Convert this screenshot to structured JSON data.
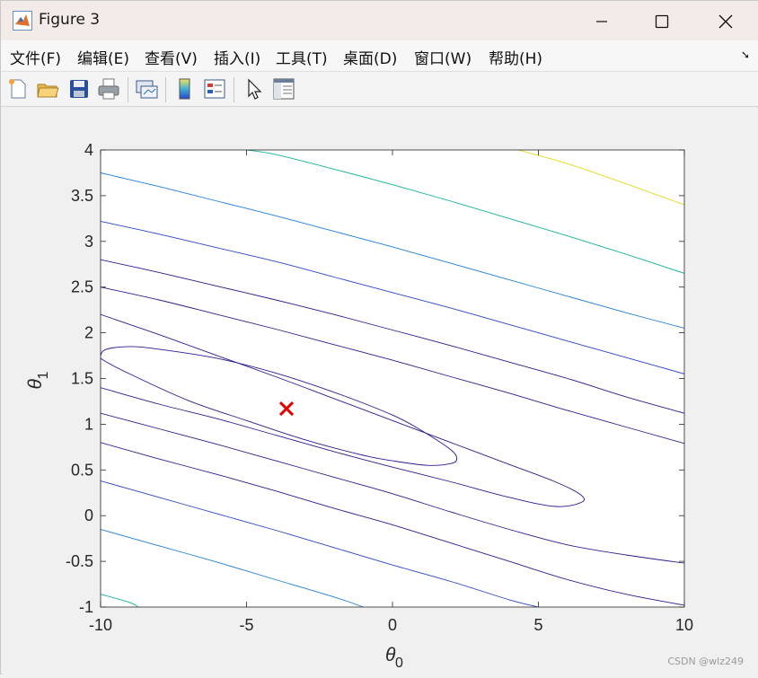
{
  "window": {
    "title": "Figure 3",
    "controls": [
      "minimize",
      "maximize",
      "close"
    ]
  },
  "menubar": {
    "items": [
      "文件(F)",
      "编辑(E)",
      "查看(V)",
      "插入(I)",
      "工具(T)",
      "桌面(D)",
      "窗口(W)",
      "帮助(H)"
    ],
    "dock_arrow": "➘"
  },
  "toolbar": {
    "icons": [
      "new-figure-icon",
      "open-file-icon",
      "save-icon",
      "print-icon",
      "link-plot-icon",
      "colorbar-icon",
      "legend-icon",
      "pointer-icon",
      "property-inspector-icon"
    ]
  },
  "chart_data": {
    "type": "contour",
    "xlim": [
      -10,
      10
    ],
    "ylim": [
      -1,
      4
    ],
    "xticks": [
      "-10",
      "-5",
      "0",
      "5",
      "10"
    ],
    "yticks": [
      "-1",
      "-0.5",
      "0",
      "0.5",
      "1",
      "1.5",
      "2",
      "2.5",
      "3",
      "3.5",
      "4"
    ],
    "xlabel_symbol": "θ",
    "xlabel_subscript": "0",
    "ylabel_symbol": "θ",
    "ylabel_subscript": "1",
    "grid": false,
    "marker": {
      "symbol": "x",
      "x": -3.63,
      "y": 1.17,
      "color": "#e00000"
    },
    "contour_colors": [
      "#2a1d8f",
      "#2b46c8",
      "#1f7fd8",
      "#14b39a",
      "#e6d81e"
    ],
    "contours": [
      {
        "level": 1,
        "color": "#2a1d8f",
        "closed": true,
        "points": [
          [
            -10,
            1.75
          ],
          [
            -9.8,
            1.82
          ],
          [
            -9.0,
            1.85
          ],
          [
            -8,
            1.82
          ],
          [
            -6,
            1.72
          ],
          [
            -4,
            1.56
          ],
          [
            -2,
            1.35
          ],
          [
            0,
            1.1
          ],
          [
            1,
            0.93
          ],
          [
            2.0,
            0.72
          ],
          [
            2.2,
            0.62
          ],
          [
            2.0,
            0.57
          ],
          [
            1.2,
            0.55
          ],
          [
            0,
            0.6
          ],
          [
            -1,
            0.66
          ],
          [
            -3,
            0.83
          ],
          [
            -5,
            1.04
          ],
          [
            -7,
            1.26
          ],
          [
            -9,
            1.55
          ],
          [
            -9.9,
            1.7
          ],
          [
            -10,
            1.75
          ]
        ]
      },
      {
        "level": 2,
        "color": "#2a1d8f",
        "closed": false,
        "points": [
          [
            -10,
            1.4
          ],
          [
            -8,
            1.22
          ],
          [
            -6,
            1.06
          ],
          [
            -4,
            0.88
          ],
          [
            -2,
            0.7
          ],
          [
            0,
            0.53
          ],
          [
            2,
            0.37
          ],
          [
            4,
            0.2
          ],
          [
            5.6,
            0.1
          ],
          [
            6.5,
            0.15
          ],
          [
            6.4,
            0.24
          ],
          [
            5.5,
            0.38
          ],
          [
            4,
            0.56
          ],
          [
            2,
            0.8
          ],
          [
            0,
            1.04
          ],
          [
            -2,
            1.28
          ],
          [
            -4,
            1.52
          ],
          [
            -6,
            1.75
          ],
          [
            -8,
            1.98
          ],
          [
            -10,
            2.2
          ]
        ]
      },
      {
        "level": 3,
        "color": "#2a1d8f",
        "closed": false,
        "points": [
          [
            -10,
            1.12
          ],
          [
            -8,
            0.95
          ],
          [
            -6,
            0.78
          ],
          [
            -4,
            0.6
          ],
          [
            -2,
            0.42
          ],
          [
            0,
            0.24
          ],
          [
            2,
            0.04
          ],
          [
            4,
            -0.15
          ],
          [
            6,
            -0.32
          ],
          [
            8,
            -0.43
          ],
          [
            10,
            -0.52
          ]
        ]
      },
      {
        "level": 3,
        "color": "#2a1d8f",
        "closed": false,
        "points": [
          [
            -10,
            2.5
          ],
          [
            -8,
            2.36
          ],
          [
            -6,
            2.2
          ],
          [
            -4,
            2.04
          ],
          [
            -2,
            1.87
          ],
          [
            0,
            1.7
          ],
          [
            2,
            1.52
          ],
          [
            4,
            1.34
          ],
          [
            6,
            1.15
          ],
          [
            8,
            0.97
          ],
          [
            10,
            0.79
          ]
        ]
      },
      {
        "level": 4,
        "color": "#2a1d8f",
        "closed": false,
        "points": [
          [
            -10,
            0.8
          ],
          [
            -8,
            0.62
          ],
          [
            -6,
            0.45
          ],
          [
            -4,
            0.27
          ],
          [
            -2,
            0.08
          ],
          [
            0,
            -0.1
          ],
          [
            2,
            -0.3
          ],
          [
            4,
            -0.5
          ],
          [
            6,
            -0.7
          ],
          [
            8,
            -0.86
          ],
          [
            10,
            -0.98
          ]
        ]
      },
      {
        "level": 4,
        "color": "#2a1d8f",
        "closed": false,
        "points": [
          [
            -10,
            2.8
          ],
          [
            -8,
            2.66
          ],
          [
            -6,
            2.51
          ],
          [
            -4,
            2.36
          ],
          [
            -2,
            2.2
          ],
          [
            0,
            2.03
          ],
          [
            2,
            1.86
          ],
          [
            4,
            1.68
          ],
          [
            6,
            1.5
          ],
          [
            8,
            1.3
          ],
          [
            10,
            1.12
          ]
        ]
      },
      {
        "level": 5,
        "color": "#2b46c8",
        "closed": false,
        "points": [
          [
            -10,
            0.38
          ],
          [
            -8,
            0.2
          ],
          [
            -6,
            0.02
          ],
          [
            -4,
            -0.16
          ],
          [
            -2,
            -0.35
          ],
          [
            0,
            -0.54
          ],
          [
            2,
            -0.72
          ],
          [
            4,
            -0.92
          ],
          [
            5,
            -1.0
          ]
        ]
      },
      {
        "level": 5,
        "color": "#2b46c8",
        "closed": false,
        "points": [
          [
            -10,
            3.22
          ],
          [
            -8,
            3.08
          ],
          [
            -6,
            2.93
          ],
          [
            -4,
            2.78
          ],
          [
            -2,
            2.61
          ],
          [
            0,
            2.44
          ],
          [
            2,
            2.27
          ],
          [
            4,
            2.09
          ],
          [
            6,
            1.91
          ],
          [
            8,
            1.73
          ],
          [
            10,
            1.55
          ]
        ]
      },
      {
        "level": 6,
        "color": "#1f7fd8",
        "closed": false,
        "points": [
          [
            -10,
            -0.15
          ],
          [
            -8,
            -0.33
          ],
          [
            -6,
            -0.51
          ],
          [
            -4,
            -0.7
          ],
          [
            -2,
            -0.89
          ],
          [
            -1,
            -1.0
          ]
        ]
      },
      {
        "level": 6,
        "color": "#1f7fd8",
        "closed": false,
        "points": [
          [
            -10,
            3.75
          ],
          [
            -8,
            3.6
          ],
          [
            -6,
            3.44
          ],
          [
            -4,
            3.28
          ],
          [
            -2,
            3.11
          ],
          [
            0,
            2.94
          ],
          [
            2,
            2.76
          ],
          [
            4,
            2.58
          ],
          [
            6,
            2.4
          ],
          [
            8,
            2.22
          ],
          [
            10,
            2.05
          ]
        ]
      },
      {
        "level": 7,
        "color": "#14b39a",
        "closed": false,
        "points": [
          [
            -10,
            -0.86
          ],
          [
            -9,
            -0.95
          ],
          [
            -8.7,
            -1.0
          ]
        ]
      },
      {
        "level": 7,
        "color": "#14b39a",
        "closed": false,
        "points": [
          [
            -5,
            4.0
          ],
          [
            -4,
            3.95
          ],
          [
            -2,
            3.79
          ],
          [
            0,
            3.62
          ],
          [
            2,
            3.44
          ],
          [
            4,
            3.25
          ],
          [
            6,
            3.06
          ],
          [
            8,
            2.86
          ],
          [
            10,
            2.65
          ]
        ]
      },
      {
        "level": 8,
        "color": "#e6d81e",
        "closed": false,
        "points": [
          [
            4.3,
            4.0
          ],
          [
            6,
            3.85
          ],
          [
            8,
            3.63
          ],
          [
            10,
            3.4
          ]
        ]
      }
    ]
  },
  "watermark": "CSDN @wlz249"
}
